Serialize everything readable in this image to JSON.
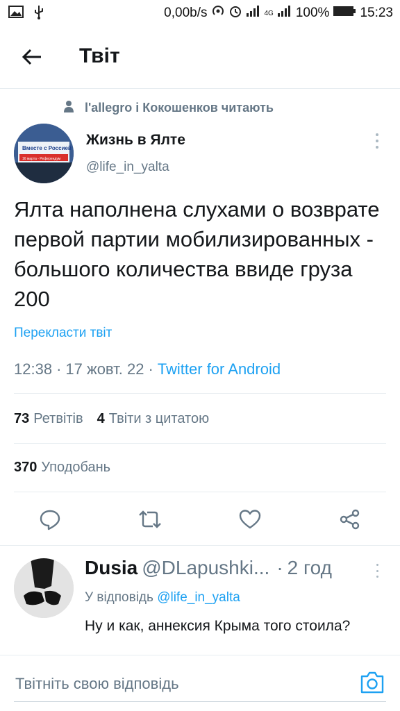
{
  "status_bar": {
    "network_speed": "0,00b/s",
    "signal_label": "4G",
    "battery": "100%",
    "time": "15:23",
    "icons": [
      "gallery-icon",
      "usb-icon",
      "hotspot-icon",
      "alarm-icon",
      "signal-icon",
      "battery-icon"
    ]
  },
  "header": {
    "title": "Твіт"
  },
  "social_context": {
    "text": "l'allegro і Кокошенков читають"
  },
  "tweet": {
    "author_name": "Жизнь в Ялте",
    "author_handle": "@life_in_yalta",
    "avatar_banner_text": "Вместе с Россией",
    "avatar_banner_sub": "16 марта - Референдум",
    "text": "Ялта наполнена слухами о возврате первой партии мобилизированных - большого количества ввиде груза 200",
    "translate_label": "Перекласти твіт",
    "time": "12:38",
    "date": "17 жовт. 22",
    "separator": "·",
    "source": "Twitter for Android"
  },
  "stats": {
    "retweets_count": "73",
    "retweets_label": "Ретвітів",
    "quotes_count": "4",
    "quotes_label": "Твіти з цитатою",
    "likes_count": "370",
    "likes_label": "Уподобань"
  },
  "reply": {
    "name": "Dusia",
    "handle": "@DLapushki...",
    "dot": "·",
    "time": "2 год",
    "reply_to_prefix": "У відповідь",
    "reply_to_handle": "@life_in_yalta",
    "text": "Ну и как, аннексия Крыма того стоила?"
  },
  "compose": {
    "placeholder": "Твітніть свою відповідь"
  },
  "colors": {
    "accent": "#1da1f2",
    "secondary_text": "#657786",
    "primary_text": "#14171a",
    "divider": "#e6ecf0"
  }
}
